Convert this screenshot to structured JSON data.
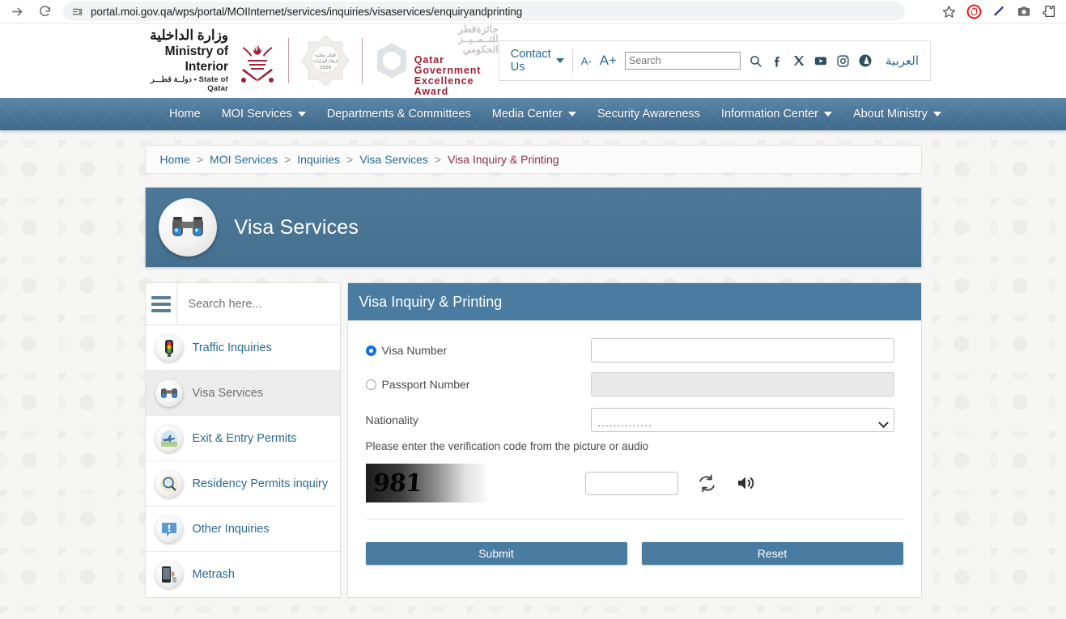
{
  "browser": {
    "url": "portal.moi.gov.qa/wps/portal/MOIInternet/services/inquiries/visaservices/enquiryandprinting",
    "icons": [
      "forward-icon",
      "reload-icon",
      "site-info-icon",
      "bookmark-star-icon",
      "adblock-icon",
      "eyedropper-icon",
      "screenshot-camera-icon",
      "extensions-icon"
    ]
  },
  "header": {
    "ministry_ar": "وزارة الداخلية",
    "ministry_en": "Ministry of Interior",
    "ministry_state": "دولــة قطـــر • State of Qatar",
    "award_ar_line1": "جائزةقطر",
    "award_ar_line2": "للتــمــيــز",
    "award_ar_line3": "الحكومي",
    "award_en_line1": "Qatar Government",
    "award_en_line2": "Excellence Award",
    "seal_ar_line1": "الفائز بجائزة",
    "seal_ar_line2": "ارتقاء الوزارات",
    "seal_year": "2024",
    "contact_us": "Contact Us",
    "font_decrease": "A-",
    "font_increase": "A+",
    "search_placeholder": "Search",
    "search_value": "",
    "arabic_link": "العربية",
    "social": [
      "search-icon",
      "facebook-icon",
      "x-twitter-icon",
      "youtube-icon",
      "instagram-icon",
      "snapchat-icon"
    ]
  },
  "nav": {
    "items": [
      {
        "label": "Home",
        "has_caret": false
      },
      {
        "label": "MOI Services",
        "has_caret": true
      },
      {
        "label": "Departments & Committees",
        "has_caret": false
      },
      {
        "label": "Media Center",
        "has_caret": true
      },
      {
        "label": "Security Awareness",
        "has_caret": false
      },
      {
        "label": "Information Center",
        "has_caret": true
      },
      {
        "label": "About Ministry",
        "has_caret": true
      }
    ]
  },
  "breadcrumb": {
    "items": [
      "Home",
      "MOI Services",
      "Inquiries",
      "Visa Services"
    ],
    "separator": ">",
    "current": "Visa Inquiry & Printing"
  },
  "banner": {
    "title": "Visa Services",
    "icon": "binoculars-icon"
  },
  "sidebar": {
    "search_placeholder": "Search here...",
    "search_value": "",
    "menu_icon": "hamburger-menu-icon",
    "items": [
      {
        "label": "Traffic Inquiries",
        "icon": "traffic-light-icon",
        "active": false
      },
      {
        "label": "Visa Services",
        "icon": "binoculars-icon",
        "active": true
      },
      {
        "label": "Exit & Entry Permits",
        "icon": "airplane-icon",
        "active": false
      },
      {
        "label": "Residency Permits inquiry",
        "icon": "magnifier-globe-icon",
        "active": false
      },
      {
        "label": "Other Inquiries",
        "icon": "exclamation-bubble-icon",
        "active": false
      },
      {
        "label": "Metrash",
        "icon": "mobile-phone-icon",
        "active": false
      }
    ]
  },
  "form": {
    "title": "Visa Inquiry & Printing",
    "visa_number_label": "Visa Number",
    "visa_number_selected": true,
    "visa_number_value": "",
    "passport_number_label": "Passport Number",
    "passport_number_selected": false,
    "passport_number_value": "",
    "passport_number_disabled": true,
    "nationality_label": "Nationality",
    "nationality_value": "..............",
    "captcha_hint": "Please enter the verification code from the picture or audio",
    "captcha_code": "981",
    "captcha_input_value": "",
    "refresh_icon": "refresh-captcha-icon",
    "audio_icon": "speaker-audio-icon",
    "submit_label": "Submit",
    "reset_label": "Reset"
  },
  "colors": {
    "nav_blue": "#4e789a",
    "panel_blue": "#4a7ba0",
    "link_blue": "#2a6b92",
    "current_crumb": "#8c2d4a",
    "maroon": "#9d2235"
  }
}
